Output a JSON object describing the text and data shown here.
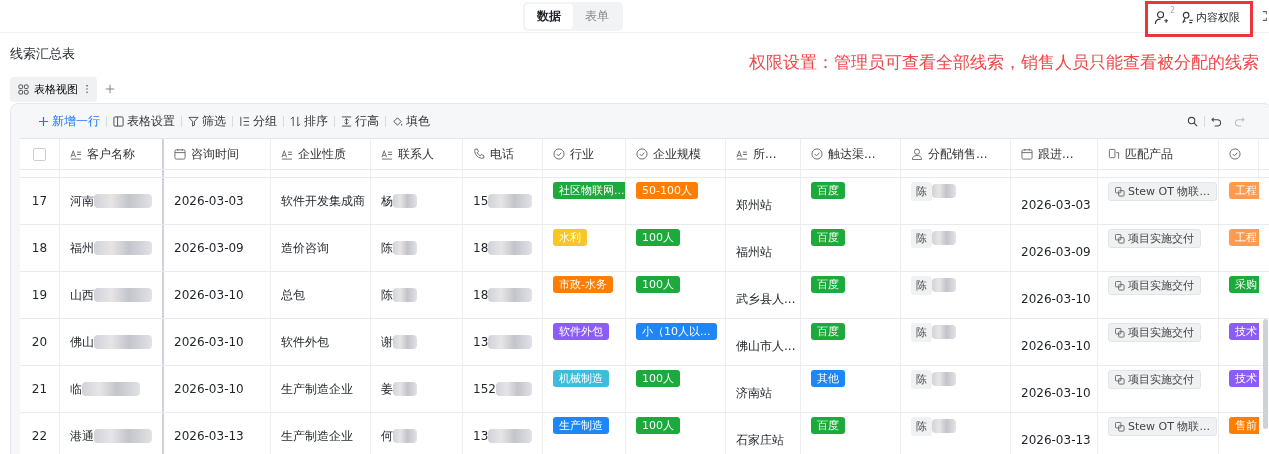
{
  "view_switch": [
    {
      "label": "数据",
      "selected": true
    },
    {
      "label": "表单",
      "selected": false
    }
  ],
  "member_count": "2",
  "permission_button": "内容权限",
  "sheet_title": "线索汇总表",
  "annotation": "权限设置：管理员可查看全部线索，销售人员只能查看被分配的线索",
  "view_tabs": [
    {
      "label": "表格视图",
      "selected": true
    }
  ],
  "toolbar": [
    {
      "kind": "add",
      "label": "新增一行"
    },
    {
      "kind": "settings",
      "label": "表格设置"
    },
    {
      "kind": "filter",
      "label": "筛选"
    },
    {
      "kind": "group",
      "label": "分组"
    },
    {
      "kind": "sort",
      "label": "排序"
    },
    {
      "kind": "height",
      "label": "行高"
    },
    {
      "kind": "fill",
      "label": "填色"
    }
  ],
  "header_checkbox": {
    "checked": false
  },
  "columns": [
    {
      "kind": "text",
      "label": "客户名称"
    },
    {
      "kind": "date",
      "label": "咨询时间"
    },
    {
      "kind": "text",
      "label": "企业性质"
    },
    {
      "kind": "text",
      "label": "联系人"
    },
    {
      "kind": "phone",
      "label": "电话"
    },
    {
      "kind": "option",
      "label": "行业"
    },
    {
      "kind": "option",
      "label": "企业规模"
    },
    {
      "kind": "text",
      "label": "所..."
    },
    {
      "kind": "option",
      "label": "触达渠..."
    },
    {
      "kind": "person",
      "label": "分配销售..."
    },
    {
      "kind": "date",
      "label": "跟进..."
    },
    {
      "kind": "link",
      "label": "匹配产品"
    },
    {
      "kind": "option"
    }
  ],
  "rows": [
    {
      "number": "17",
      "customer": "河南",
      "time": "2026-03-03",
      "nature": "软件开发集成商",
      "contact": "杨",
      "phone": "15",
      "industry": {
        "text": "社区物联网...",
        "color": "#1daa3c"
      },
      "scale": {
        "text": "50-100人",
        "color": "#ff7d00"
      },
      "location": "郑州站",
      "channel": {
        "text": "百度",
        "color": "#1daa3c"
      },
      "assignee": "陈",
      "followup": "2026-03-03",
      "product": "Stew OT 物联...",
      "role": {
        "text": "工程",
        "color": "#ff9a4e"
      }
    },
    {
      "number": "18",
      "customer": "福州",
      "time": "2026-03-09",
      "nature": "造价咨询",
      "contact": "陈",
      "phone": "18",
      "industry": {
        "text": "水利",
        "color": "#f7c727"
      },
      "scale": {
        "text": "100人",
        "color": "#1daa3c"
      },
      "location": "福州站",
      "channel": {
        "text": "百度",
        "color": "#1daa3c"
      },
      "assignee": "陈",
      "followup": "2026-03-09",
      "product": "项目实施交付",
      "role": {
        "text": "工程",
        "color": "#ff9a4e"
      }
    },
    {
      "number": "19",
      "customer": "山西",
      "time": "2026-03-10",
      "nature": "总包",
      "contact": "陈",
      "phone": "18",
      "industry": {
        "text": "市政-水务",
        "color": "#ff7d00"
      },
      "scale": {
        "text": "100人",
        "color": "#1daa3c"
      },
      "location": "武乡县人...",
      "channel": {
        "text": "百度",
        "color": "#1daa3c"
      },
      "assignee": "陈",
      "followup": "2026-03-10",
      "product": "项目实施交付",
      "role": {
        "text": "采购",
        "color": "#1daa3c"
      }
    },
    {
      "number": "20",
      "customer": "佛山",
      "time": "2026-03-10",
      "nature": "软件外包",
      "contact": "谢",
      "phone": "13",
      "industry": {
        "text": "软件外包",
        "color": "#8c5cf6"
      },
      "scale": {
        "text": "小（10人以...",
        "color": "#1e86f5"
      },
      "location": "佛山市人...",
      "channel": {
        "text": "百度",
        "color": "#1daa3c"
      },
      "assignee": "陈",
      "followup": "2026-03-10",
      "product": "项目实施交付",
      "role": {
        "text": "技术",
        "color": "#8c5cf6"
      }
    },
    {
      "number": "21",
      "customer": "临",
      "time": "2026-03-10",
      "nature": "生产制造企业",
      "contact": "姜",
      "phone": "152",
      "industry": {
        "text": "机械制造",
        "color": "#3fbcdc"
      },
      "scale": {
        "text": "100人",
        "color": "#1daa3c"
      },
      "location": "济南站",
      "channel": {
        "text": "其他",
        "color": "#1e86f5"
      },
      "assignee": "陈",
      "followup": "2026-03-10",
      "product": "项目实施交付",
      "role": {
        "text": "技术",
        "color": "#8c5cf6"
      }
    },
    {
      "number": "22",
      "customer": "港通",
      "time": "2026-03-13",
      "nature": "生产制造企业",
      "contact": "何",
      "phone": "13",
      "industry": {
        "text": "生产制造",
        "color": "#1e86f5"
      },
      "scale": {
        "text": "100人",
        "color": "#1daa3c"
      },
      "location": "石家庄站",
      "channel": {
        "text": "百度",
        "color": "#1daa3c"
      },
      "assignee": "陈",
      "followup": "2026-03-13",
      "product": "Stew OT 物联...",
      "role": {
        "text": "售前",
        "color": "#ff7d00"
      }
    }
  ]
}
